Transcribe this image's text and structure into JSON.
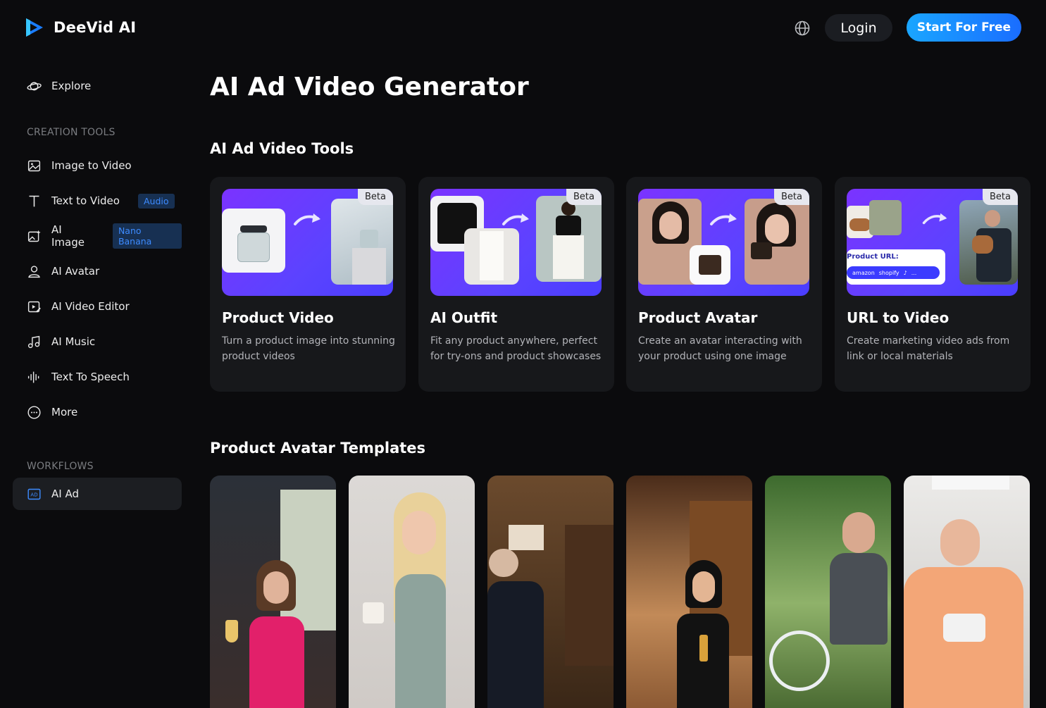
{
  "header": {
    "brand": "DeeVid AI",
    "login_label": "Login",
    "start_label": "Start For Free"
  },
  "sidebar": {
    "explore": "Explore",
    "creation_tools_title": "CREATION TOOLS",
    "items": [
      {
        "label": "Image to Video",
        "icon": "image-to-video-icon"
      },
      {
        "label": "Text to Video",
        "icon": "text-icon",
        "badge": "Audio"
      },
      {
        "label": "AI Image",
        "icon": "ai-image-icon",
        "badge": "Nano Banana"
      },
      {
        "label": "AI Avatar",
        "icon": "avatar-icon"
      },
      {
        "label": "AI Video Editor",
        "icon": "video-editor-icon"
      },
      {
        "label": "AI Music",
        "icon": "music-icon"
      },
      {
        "label": "Text To Speech",
        "icon": "waveform-icon"
      },
      {
        "label": "More",
        "icon": "more-icon"
      }
    ],
    "workflows_title": "WORKFLOWS",
    "workflow_item": "AI Ad",
    "workflow_icon_text": "AD"
  },
  "main": {
    "title": "AI Ad Video Generator",
    "tools_heading": "AI Ad Video Tools",
    "tools": [
      {
        "title": "Product Video",
        "desc": "Turn a product image into stunning product videos",
        "badge": "Beta"
      },
      {
        "title": "AI Outfit",
        "desc": "Fit any product anywhere, perfect for try-ons and product showcases",
        "badge": "Beta"
      },
      {
        "title": "Product Avatar",
        "desc": "Create an avatar interacting with your product using one image",
        "badge": "Beta"
      },
      {
        "title": "URL to Video",
        "desc": "Create marketing video ads from link or local materials",
        "badge": "Beta"
      }
    ],
    "url_card": {
      "product_url_label": "Product URL:",
      "stores": [
        "amazon",
        "shopify",
        "♪",
        "..."
      ]
    },
    "templates_heading": "Product Avatar Templates"
  }
}
